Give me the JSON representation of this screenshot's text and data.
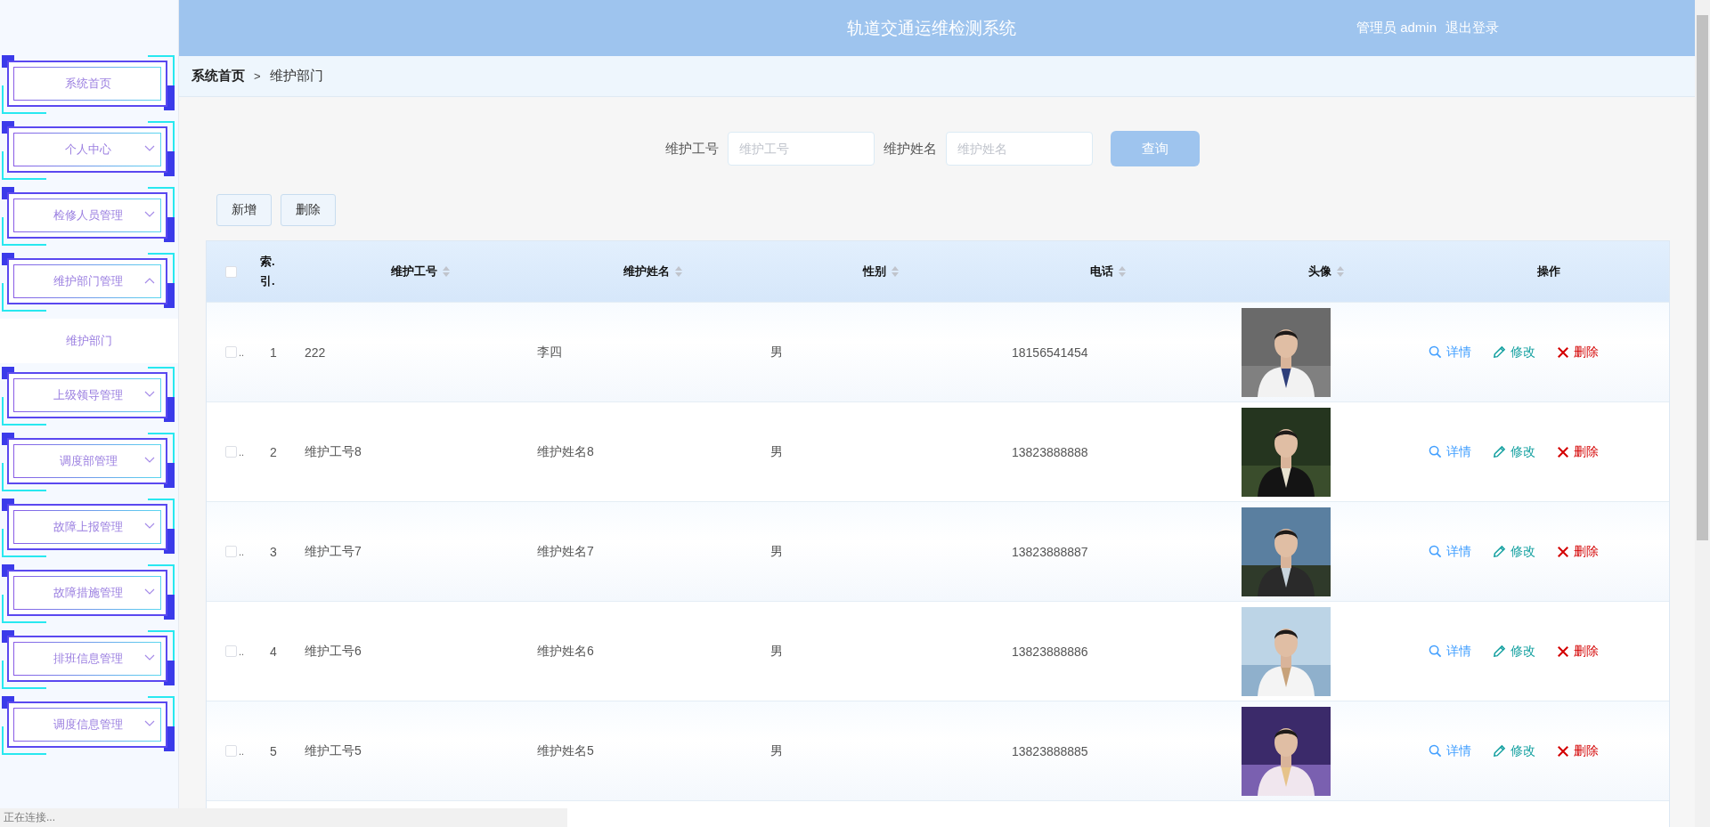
{
  "header": {
    "title": "轨道交通运维检测系统",
    "user": "管理员 admin",
    "logout": "退出登录"
  },
  "sidebar": {
    "items": [
      {
        "label": "系统首页"
      },
      {
        "label": "个人中心",
        "expanded": false
      },
      {
        "label": "检修人员管理",
        "expanded": false
      },
      {
        "label": "维护部门管理",
        "expanded": true,
        "children": [
          {
            "label": "维护部门",
            "selected": true
          }
        ]
      },
      {
        "label": "上级领导管理",
        "expanded": false
      },
      {
        "label": "调度部管理",
        "expanded": false
      },
      {
        "label": "故障上报管理",
        "expanded": false
      },
      {
        "label": "故障措施管理",
        "expanded": false
      },
      {
        "label": "排班信息管理",
        "expanded": false
      },
      {
        "label": "调度信息管理",
        "expanded": false
      }
    ]
  },
  "breadcrumb": {
    "items": [
      "系统首页",
      "维护部门"
    ],
    "separator": ">"
  },
  "search": {
    "fields": [
      {
        "label": "维护工号",
        "placeholder": "维护工号"
      },
      {
        "label": "维护姓名",
        "placeholder": "维护姓名"
      }
    ],
    "button": "查询"
  },
  "toolbar": [
    "新增",
    "删除"
  ],
  "table": {
    "header_checked": false,
    "columns": [
      {
        "label": "索. 引.",
        "sortable": false
      },
      {
        "label": "维护工号",
        "sortable": true
      },
      {
        "label": "维护姓名",
        "sortable": true
      },
      {
        "label": "性别",
        "sortable": true
      },
      {
        "label": "电话",
        "sortable": true
      },
      {
        "label": "头像",
        "sortable": true
      },
      {
        "label": "操作",
        "sortable": false
      }
    ],
    "rows": [
      {
        "checked": false,
        "checkbox_suffix": "..",
        "index": "1",
        "id": "222",
        "name": "李四",
        "gender": "男",
        "phone": "18156541454",
        "actions": [
          {
            "kind": "detail",
            "label": "详情"
          },
          {
            "kind": "edit",
            "label": "修改"
          },
          {
            "kind": "delete",
            "label": "删除"
          }
        ]
      },
      {
        "checked": false,
        "checkbox_suffix": "..",
        "index": "2",
        "id": "维护工号8",
        "name": "维护姓名8",
        "gender": "男",
        "phone": "13823888888",
        "actions": [
          {
            "kind": "detail",
            "label": "详情"
          },
          {
            "kind": "edit",
            "label": "修改"
          },
          {
            "kind": "delete",
            "label": "删除"
          }
        ]
      },
      {
        "checked": false,
        "checkbox_suffix": "..",
        "index": "3",
        "id": "维护工号7",
        "name": "维护姓名7",
        "gender": "男",
        "phone": "13823888887",
        "actions": [
          {
            "kind": "detail",
            "label": "详情"
          },
          {
            "kind": "edit",
            "label": "修改"
          },
          {
            "kind": "delete",
            "label": "删除"
          }
        ]
      },
      {
        "checked": false,
        "checkbox_suffix": "..",
        "index": "4",
        "id": "维护工号6",
        "name": "维护姓名6",
        "gender": "男",
        "phone": "13823888886",
        "actions": [
          {
            "kind": "detail",
            "label": "详情"
          },
          {
            "kind": "edit",
            "label": "修改"
          },
          {
            "kind": "delete",
            "label": "删除"
          }
        ]
      },
      {
        "checked": false,
        "checkbox_suffix": "..",
        "index": "5",
        "id": "维护工号5",
        "name": "维护姓名5",
        "gender": "男",
        "phone": "13823888885",
        "actions": [
          {
            "kind": "detail",
            "label": "详情"
          },
          {
            "kind": "edit",
            "label": "修改"
          },
          {
            "kind": "delete",
            "label": "删除"
          }
        ]
      }
    ]
  },
  "status_text": "正在连接..."
}
